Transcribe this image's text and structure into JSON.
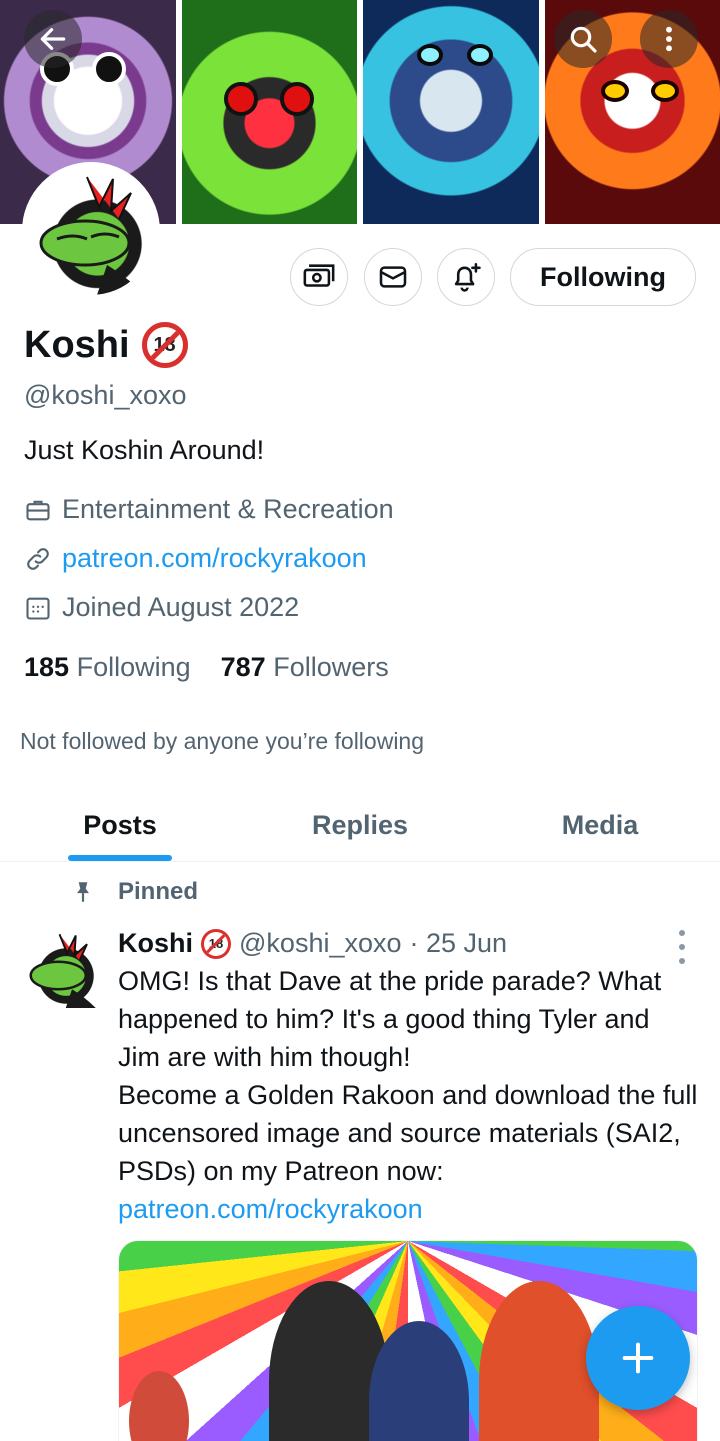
{
  "header": {
    "back_icon": "arrow-left-icon",
    "search_icon": "search-icon",
    "more_icon": "more-vertical-icon"
  },
  "profile": {
    "name": "Koshi",
    "badge": "18",
    "handle": "@koshi_xoxo",
    "bio": "Just Koshin Around!",
    "category": "Entertainment & Recreation",
    "link": "patreon.com/rockyrakoon",
    "joined": "Joined August 2022",
    "following_count": "185",
    "following_label": "Following",
    "followers_count": "787",
    "followers_label": "Followers",
    "followed_by": "Not followed by anyone you’re following"
  },
  "actions": {
    "follow_button": "Following",
    "icons": [
      "money-icon",
      "mail-icon",
      "bell-plus-icon"
    ]
  },
  "tabs": [
    {
      "label": "Posts",
      "active": true
    },
    {
      "label": "Replies",
      "active": false
    },
    {
      "label": "Media",
      "active": false
    }
  ],
  "post": {
    "pinned_label": "Pinned",
    "author": "Koshi",
    "badge": "18",
    "handle": "@koshi_xoxo",
    "date": "· 25 Jun",
    "line1": "OMG! Is that Dave at the pride parade? What happened to him? It's a good thing Tyler and Jim are with him though!",
    "line2": "Become a Golden Rakoon and download the full uncensored image and source materials (SAI2, PSDs) on my Patreon now:",
    "link": "patreon.com/rockyrakoon"
  },
  "colors": {
    "accent": "#1d9bf0",
    "secondary_text": "#536471",
    "primary_text": "#0f1419"
  }
}
